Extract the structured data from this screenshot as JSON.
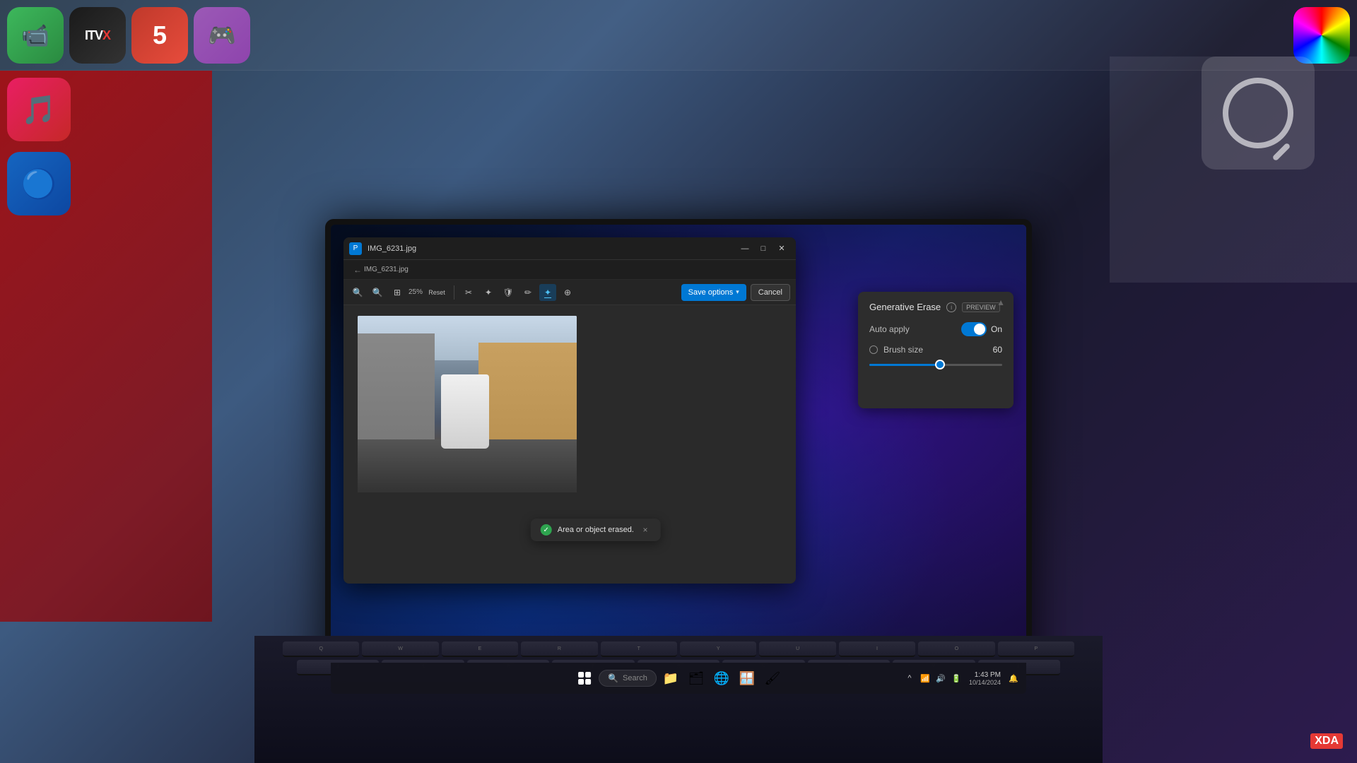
{
  "background": {
    "color": "#1a1a2e"
  },
  "desktop_icons": {
    "top_row": [
      {
        "label": "FaceTime",
        "emoji": "📹",
        "class": "icon-facetime"
      },
      {
        "label": "ITVX",
        "text": "ITV X",
        "class": "icon-itvx"
      },
      {
        "label": "Channel 5",
        "text": "5",
        "class": "icon-ch5"
      },
      {
        "label": "Game",
        "emoji": "🎮",
        "class": "icon-game"
      },
      {
        "label": "Color Wheel",
        "class": "icon-colorwheel"
      }
    ]
  },
  "paint_window": {
    "title": "IMG_6231.jpg",
    "logo_text": "P",
    "toolbar": {
      "zoom": "25%",
      "reset": "Reset",
      "tools": [
        "crop",
        "sparkle",
        "shield",
        "pen",
        "erase",
        "star"
      ]
    },
    "actions": {
      "save_options_label": "Save options",
      "cancel_label": "Cancel"
    },
    "gen_erase_panel": {
      "title": "Generative Erase",
      "badge": "PREVIEW",
      "info_tooltip": "i",
      "auto_apply_label": "Auto apply",
      "toggle_state": "On",
      "toggle_on": true,
      "brush_size_label": "Brush size",
      "brush_size_value": "60",
      "slider_percent": 55
    },
    "toast": {
      "text": "Area or object erased.",
      "close": "×"
    }
  },
  "taskbar": {
    "search_placeholder": "Search",
    "time": "1:43 PM",
    "date": "10/14/2024",
    "notification_dot": true,
    "icons": [
      "file-explorer",
      "folder",
      "edge",
      "windows-store",
      "paint"
    ]
  },
  "xda_logo": {
    "box": "XDA",
    "suffix": ""
  },
  "window_controls": {
    "minimize": "—",
    "maximize": "□",
    "close": "✕"
  }
}
